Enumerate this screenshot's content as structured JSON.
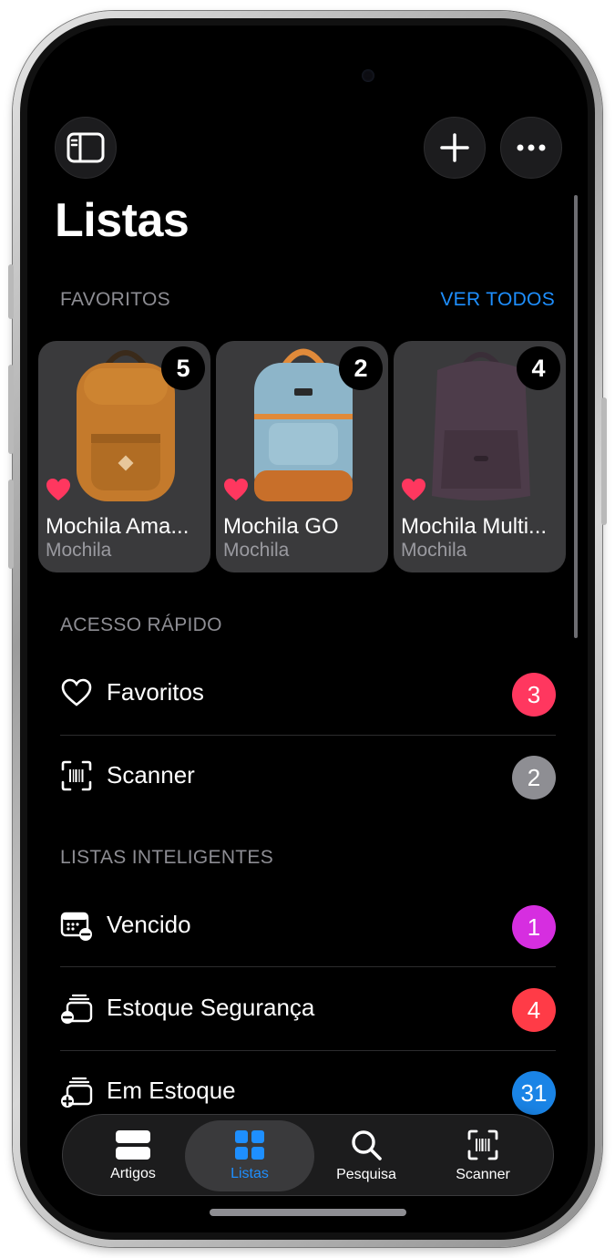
{
  "header": {
    "title": "Listas"
  },
  "favorites_section": {
    "label": "FAVORITOS",
    "see_all": "VER TODOS",
    "items": [
      {
        "name": "Mochila Ama...",
        "category": "Mochila",
        "count": "5",
        "bag_color": "#c47a2c"
      },
      {
        "name": "Mochila GO",
        "category": "Mochila",
        "count": "2",
        "bag_color": "#8db5c9"
      },
      {
        "name": "Mochila Multi...",
        "category": "Mochila",
        "count": "4",
        "bag_color": "#4d3c4a"
      }
    ]
  },
  "quick_access": {
    "label": "ACESSO RÁPIDO",
    "items": [
      {
        "label": "Favoritos",
        "count": "3",
        "color": "#ff375f",
        "icon": "heart-outline-icon"
      },
      {
        "label": "Scanner",
        "count": "2",
        "color": "#8e8e93",
        "icon": "barcode-scanner-icon"
      }
    ]
  },
  "smart_lists": {
    "label": "LISTAS INTELIGENTES",
    "items": [
      {
        "label": "Vencido",
        "count": "1",
        "color": "#d62ee0",
        "icon": "calendar-minus-icon"
      },
      {
        "label": "Estoque Segurança",
        "count": "4",
        "color": "#ff3b47",
        "icon": "stack-minus-icon"
      },
      {
        "label": "Em Estoque",
        "count": "31",
        "color": "#1a84e6",
        "icon": "stack-plus-icon"
      }
    ]
  },
  "tab_bar": {
    "tabs": [
      {
        "label": "Artigos",
        "icon": "items-icon",
        "active": false
      },
      {
        "label": "Listas",
        "icon": "grid-icon",
        "active": true
      },
      {
        "label": "Pesquisa",
        "icon": "search-icon",
        "active": false
      },
      {
        "label": "Scanner",
        "icon": "barcode-scanner-icon",
        "active": false
      }
    ]
  },
  "colors": {
    "accent": "#1e8fff",
    "background": "#000000",
    "card": "#3a3a3c",
    "heart": "#ff375f"
  }
}
